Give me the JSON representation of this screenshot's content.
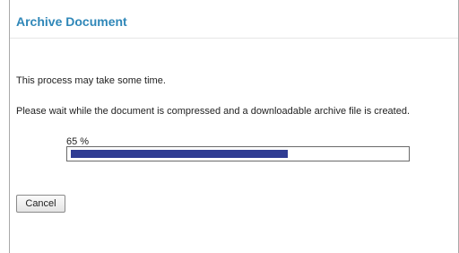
{
  "dialog": {
    "title": "Archive Document",
    "message_1": "This process may take some time.",
    "message_2": "Please wait while the document is compressed and a downloadable archive file is created."
  },
  "progress": {
    "label": "65 %",
    "fraction": 0.65,
    "fill_color": "#2f3c93"
  },
  "actions": {
    "cancel_label": "Cancel"
  },
  "colors": {
    "title": "#2f87b8",
    "progress_fill": "#2f3c93"
  }
}
